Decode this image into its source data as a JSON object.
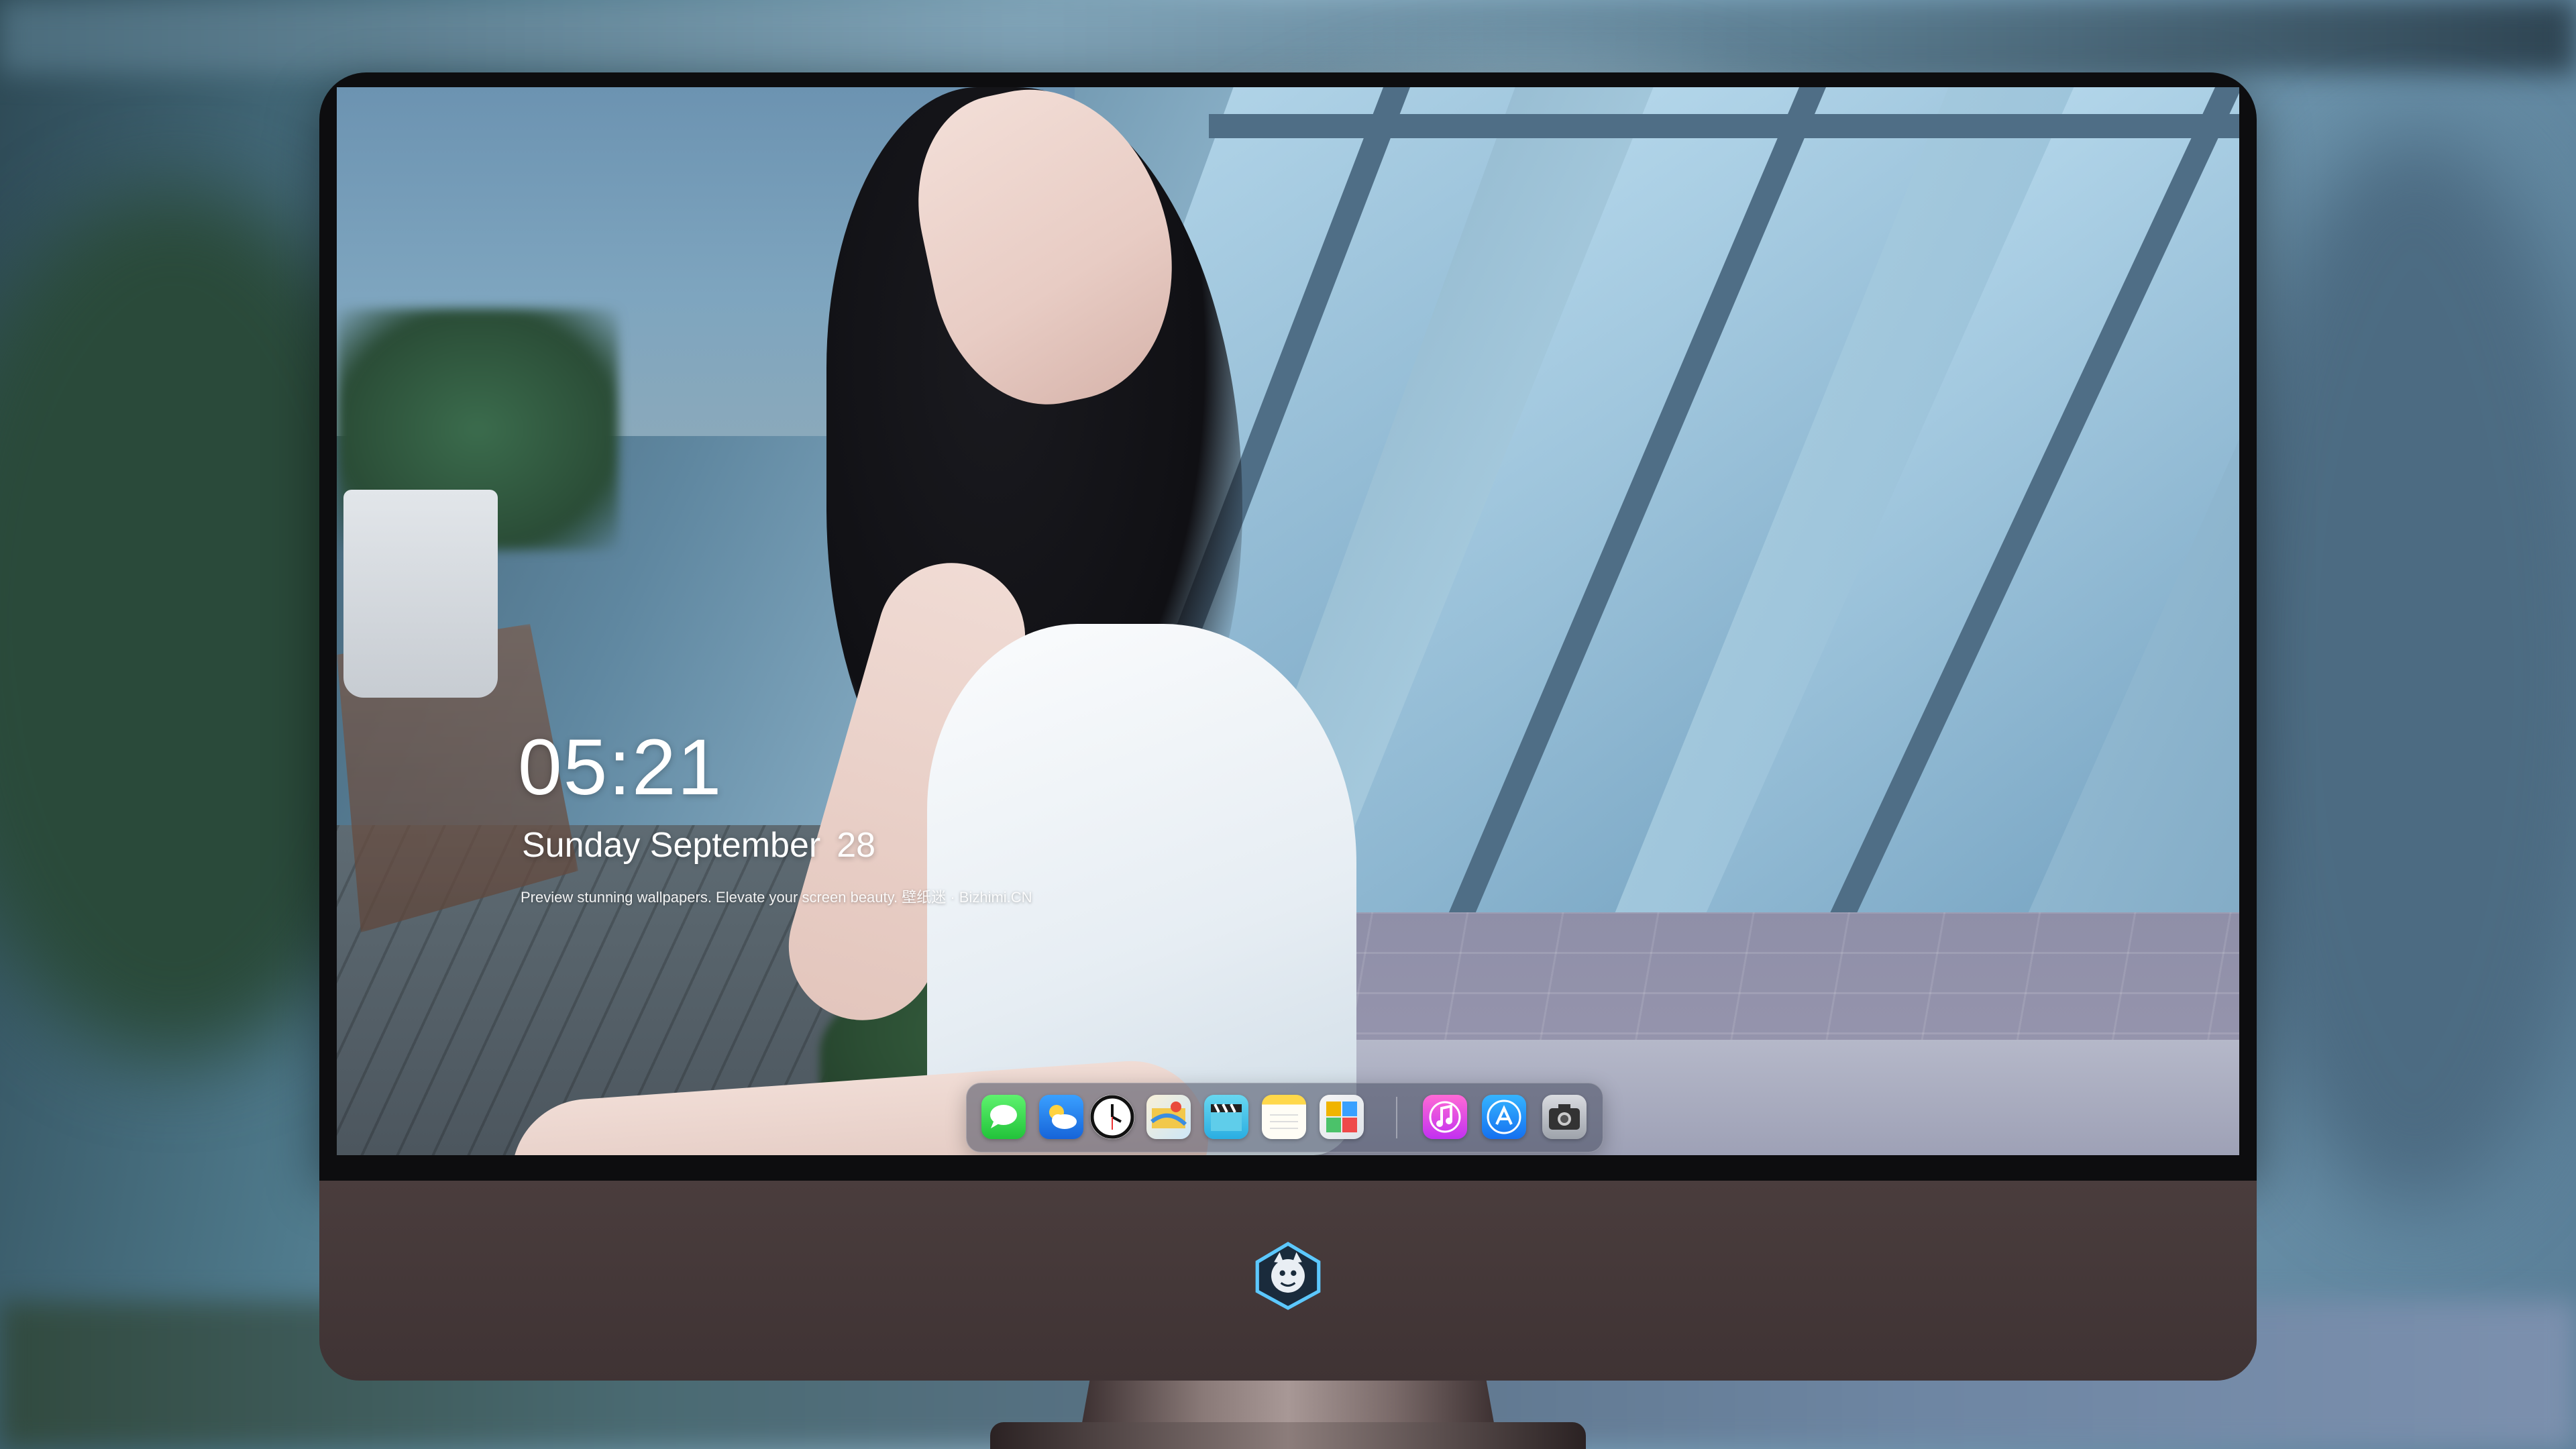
{
  "lock_screen": {
    "time": "05:21",
    "date_text": "Sunday September",
    "day_number": "28",
    "tagline": "Preview stunning wallpapers. Elevate your screen beauty. 壁纸迷 · Bizhimi.CN"
  },
  "dock": {
    "apps": [
      {
        "name": "Messages",
        "icon": "messages-icon"
      },
      {
        "name": "Weather",
        "icon": "weather-icon"
      },
      {
        "name": "Clock",
        "icon": "clock-icon"
      },
      {
        "name": "Maps",
        "icon": "maps-icon"
      },
      {
        "name": "Videos",
        "icon": "clapperboard-icon"
      },
      {
        "name": "Notes",
        "icon": "notes-icon"
      },
      {
        "name": "Photos",
        "icon": "photos-icon"
      },
      {
        "name": "Music",
        "icon": "music-note-icon"
      },
      {
        "name": "App Store",
        "icon": "app-store-icon"
      },
      {
        "name": "Camera",
        "icon": "camera-icon"
      }
    ]
  },
  "monitor": {
    "chin_logo": "mascot-logo-icon"
  },
  "colors": {
    "monitor_chin": "#4a3d3d",
    "bezel": "#0d0d0f",
    "dock_bg": "rgba(70,75,95,0.55)",
    "clock_text": "#ffffff"
  }
}
